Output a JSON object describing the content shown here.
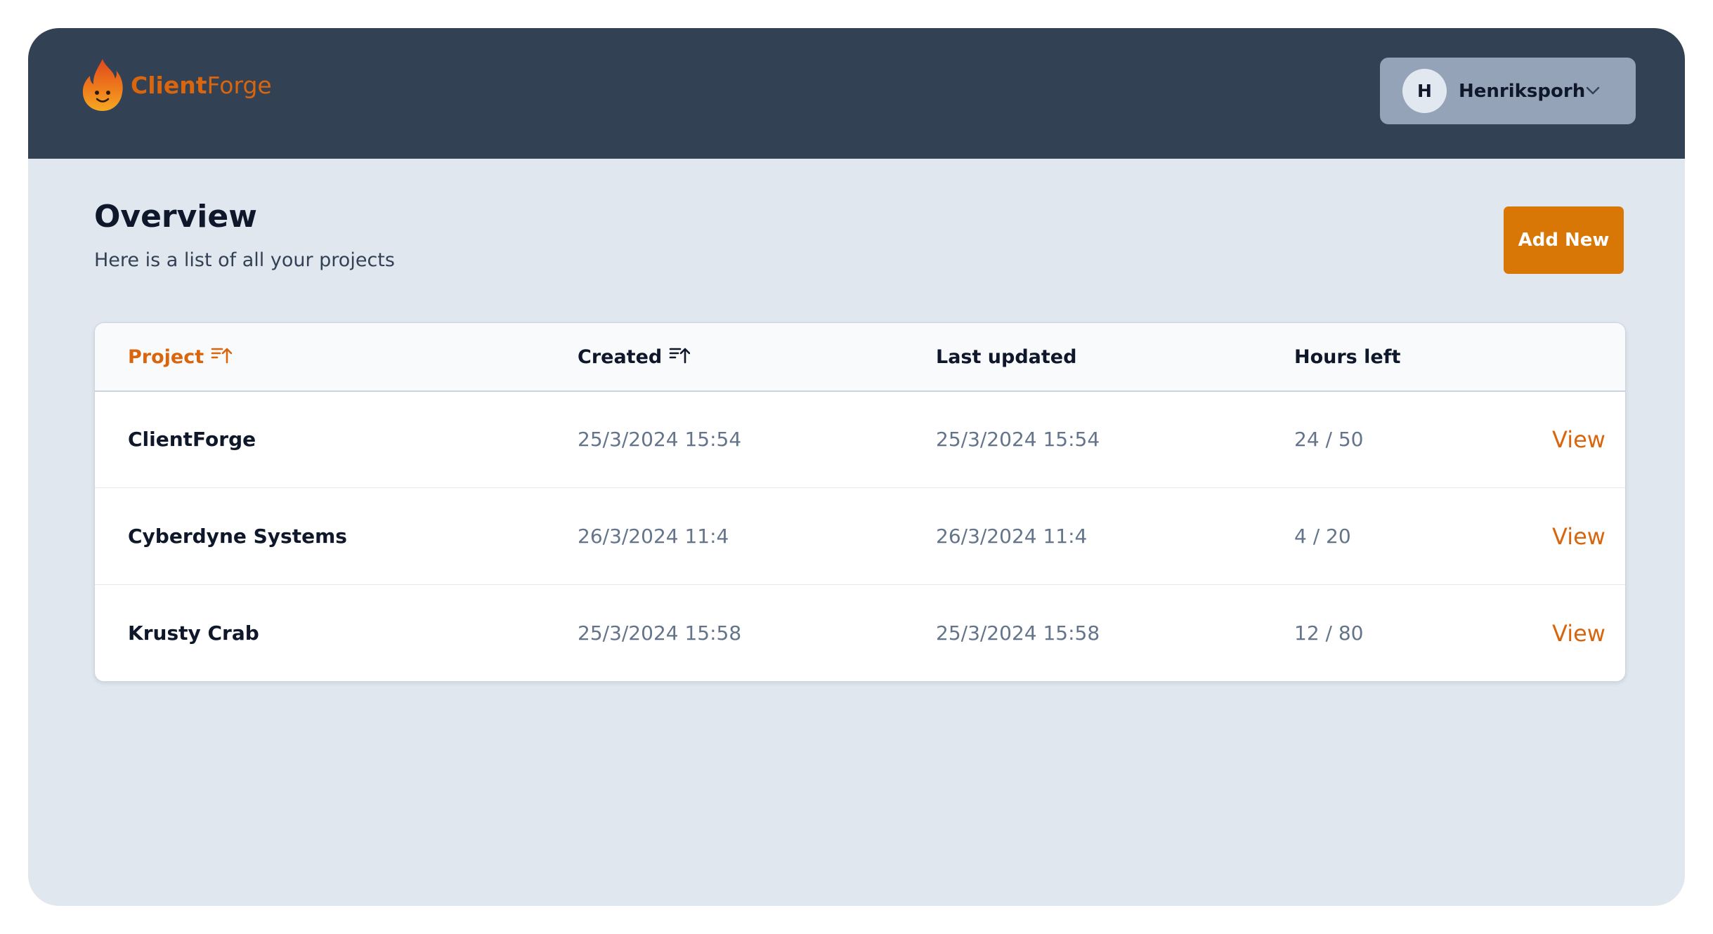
{
  "brand": {
    "name_bold": "Client",
    "name_light": "Forge",
    "logo_icon": "flame-mascot-icon"
  },
  "user": {
    "initial": "H",
    "name": "Henriksporh",
    "menu_icon": "chevron-down-icon"
  },
  "page": {
    "title": "Overview",
    "subtitle": "Here is a list of all your projects",
    "add_button": "Add New"
  },
  "table": {
    "headers": {
      "project": "Project",
      "created": "Created",
      "last_updated": "Last updated",
      "hours_left": "Hours left"
    },
    "sort_icon": "sort-ascending-icon",
    "rows": [
      {
        "project": "ClientForge",
        "created": "25/3/2024 15:54",
        "last_updated": "25/3/2024 15:54",
        "hours_left": "24 / 50",
        "action": "View"
      },
      {
        "project": "Cyberdyne Systems",
        "created": "26/3/2024 11:4",
        "last_updated": "26/3/2024 11:4",
        "hours_left": "4 / 20",
        "action": "View"
      },
      {
        "project": "Krusty Crab",
        "created": "25/3/2024 15:58",
        "last_updated": "25/3/2024 15:58",
        "hours_left": "12 / 80",
        "action": "View"
      }
    ]
  },
  "colors": {
    "header_bg": "#334155",
    "page_bg": "#e1e7ef",
    "accent": "#d97706",
    "user_menu_bg": "#94a3b8"
  }
}
